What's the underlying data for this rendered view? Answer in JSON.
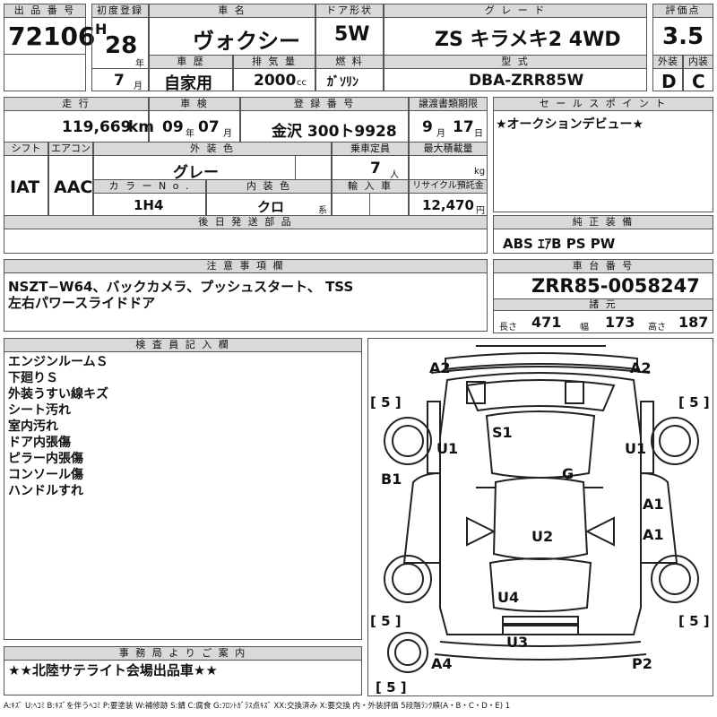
{
  "header": {
    "lot_label": "出 品 番 号",
    "lot_number": "72106",
    "first_reg_label": "初度登録",
    "era": "H",
    "first_reg_year": "28",
    "year_unit": "年",
    "first_reg_month": "7",
    "month_unit": "月",
    "car_name_label": "車 名",
    "car_name": "ヴォクシー",
    "door_label": "ドア形状",
    "door": "5W",
    "grade_label": "グ レ ー ド",
    "grade": "ZS キラメキ2 4WD",
    "score_label": "評価点",
    "score": "3.5",
    "history_label": "車 歴",
    "history": "自家用",
    "displacement_label": "排 気 量",
    "displacement": "2000",
    "displacement_unit": "cc",
    "fuel_label": "燃 料",
    "fuel": "ｶﾞｿﾘﾝ",
    "model_label": "型 式",
    "model": "DBA-ZRR85W",
    "ext_grade_label": "外装",
    "ext_grade": "D",
    "int_grade_label": "内装",
    "int_grade": "C"
  },
  "row2": {
    "mileage_label": "走 行",
    "mileage": "119,669",
    "mileage_unit": "km",
    "inspection_label": "車 検",
    "insp_year": "09",
    "insp_year_unit": "年",
    "insp_month": "07",
    "insp_month_unit": "月",
    "plate_label": "登 録 番 号",
    "plate": "金沢 300ト9928",
    "transfer_label": "譲渡書類期限",
    "transfer_month": "9",
    "transfer_month_unit": "月",
    "transfer_day": "17",
    "transfer_day_unit": "日",
    "sales_point_label": "セ ー ル ス ポ イ ン ト",
    "sales_point": "★オークションデビュー★"
  },
  "row3": {
    "shift_label": "シフト",
    "shift": "IAT",
    "ac_label": "エアコン",
    "ac": "AAC",
    "ext_color_label": "外 装 色",
    "ext_color": "グレー",
    "capacity_label": "乗車定員",
    "capacity": "7",
    "capacity_unit": "人",
    "max_load_label": "最大積載量",
    "max_load_unit": "kg",
    "color_no_label": "カ ラ ー N o .",
    "color_no": "1H4",
    "int_color_label": "内 装 色",
    "int_color": "クロ",
    "int_color_unit": "系",
    "import_label": "輸 入 車",
    "recycle_label": "リサイクル預託金",
    "recycle": "12,470",
    "recycle_unit": "円"
  },
  "later_parts_label": "後 日 発 送 部 品",
  "genuine_label": "純 正 装 備",
  "genuine": "ABS ｴｱB PS PW",
  "notes": {
    "label": "注 意 事 項 欄",
    "line1": "NSZT−W64、バックカメラ、プッシュスタート、 TSS",
    "line2": "左右パワースライドドア"
  },
  "chassis": {
    "label": "車 台 番 号",
    "number": "ZRR85-0058247",
    "spec_label": "諸 元",
    "length_label": "長さ",
    "length": "471",
    "width_label": "幅",
    "width": "173",
    "height_label": "高さ",
    "height": "187"
  },
  "inspector": {
    "label": "検 査 員 記 入 欄",
    "lines": [
      "エンジンルームＳ",
      "下廻りＳ",
      "外装うすい線キズ",
      "シート汚れ",
      "室内汚れ",
      "ドア内張傷",
      "ピラー内張傷",
      "コンソール傷",
      "ハンドルすれ"
    ]
  },
  "diagram": {
    "marks": [
      "A2",
      "A2",
      "S1",
      "U1",
      "U1",
      "B1",
      "G",
      "A1",
      "A1",
      "U2",
      "U4",
      "U3",
      "A4",
      "P2"
    ],
    "tire_labels": [
      "[ 5 ]",
      "[ 5 ]",
      "[ 5 ]",
      "[ 5 ]",
      "[ 5 ]"
    ]
  },
  "office": {
    "label": "事 務 局 よ り ご 案 内",
    "text": "★★北陸サテライト会場出品車★★"
  },
  "legend": "A:ｷｽﾞ U:ﾍｺﾐ B:ｷｽﾞを伴うﾍｺﾐ P:要塗装 W:補修跡 S:錆 C:腐食 G:ﾌﾛﾝﾄｶﾞﾗｽ点ｷｽﾞ XX:交換済み X:要交換 内・外装評価 5段階ﾗﾝｸ順(A・B・C・D・E) 1"
}
